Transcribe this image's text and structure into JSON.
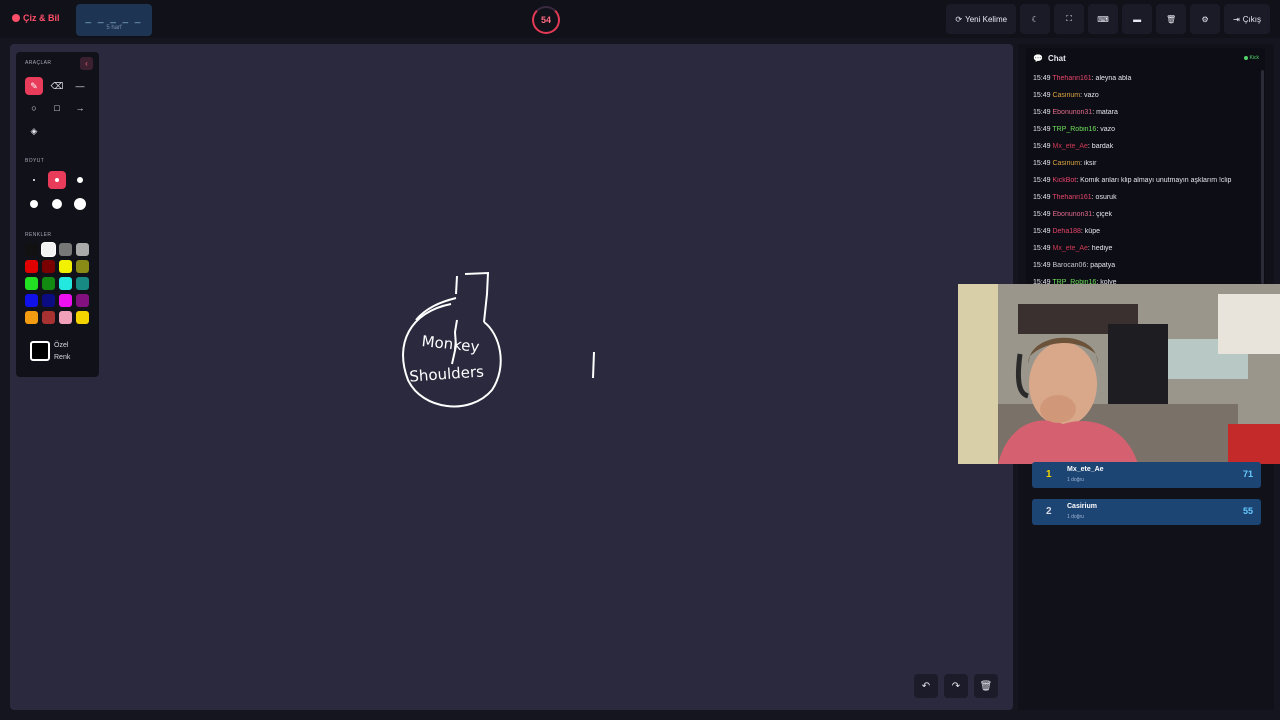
{
  "header": {
    "logo": "Çiz & Bil",
    "word_mask": "_ _ _ _ _",
    "word_hint": "5 harf",
    "timer": "54",
    "new_word": "Yeni Kelime",
    "exit": "Çıkış"
  },
  "tools": {
    "section_tools": "ARAÇLAR",
    "section_size": "BOYUT",
    "section_colors": "RENKLER",
    "custom_color_line1": "Özel",
    "custom_color_line2": "Renk",
    "colors": [
      "#111111",
      "#f2f2f2",
      "#777777",
      "#aaaaaa",
      "#e00000",
      "#7a0000",
      "#f2f200",
      "#8a8a16",
      "#22e022",
      "#128a12",
      "#22e8e0",
      "#178a84",
      "#1010e8",
      "#0c0c82",
      "#ee10ee",
      "#82107e",
      "#f39c12",
      "#a83232",
      "#f0a0b8",
      "#f3d400"
    ]
  },
  "drawing_text": "Monkey Shoulders",
  "chat": {
    "title": "Chat",
    "platform": "Kick",
    "messages": [
      {
        "time": "15:49",
        "user": "Thehanri161",
        "color": "#e8456a",
        "text": ": aleyna abla"
      },
      {
        "time": "15:49",
        "user": "Casirium",
        "color": "#d9a441",
        "text": ": vazo"
      },
      {
        "time": "15:49",
        "user": "Ebonunon31",
        "color": "#e06a8a",
        "text": ": matara"
      },
      {
        "time": "15:49",
        "user": "TRP_Robin16",
        "color": "#6fe05b",
        "text": ": vazo"
      },
      {
        "time": "15:49",
        "user": "Mx_ete_Ae",
        "color": "#cf3a55",
        "text": ": bardak"
      },
      {
        "time": "15:49",
        "user": "Casirium",
        "color": "#d9a441",
        "text": ": iksir"
      },
      {
        "time": "15:49",
        "user": "KickBot",
        "color": "#e8456a",
        "text": ": Komik anları klip almayı unutmayın aşklarım !clip"
      },
      {
        "time": "15:49",
        "user": "Thehanri161",
        "color": "#e8456a",
        "text": ": osuruk"
      },
      {
        "time": "15:49",
        "user": "Ebonunon31",
        "color": "#e06a8a",
        "text": ": çiçek"
      },
      {
        "time": "15:49",
        "user": "Deha188",
        "color": "#e8456a",
        "text": ": küpe"
      },
      {
        "time": "15:49",
        "user": "Mx_ete_Ae",
        "color": "#cf3a55",
        "text": ": hediye"
      },
      {
        "time": "15:49",
        "user": "Barocan06",
        "color": "#c8c8d4",
        "text": ": papatya"
      },
      {
        "time": "15:49",
        "user": "TRP_Robin16",
        "color": "#6fe05b",
        "text": ": kolye"
      }
    ]
  },
  "leaderboard": [
    {
      "rank": "1",
      "rank_color": "#f3d400",
      "name": "Mx_ete_Ae",
      "sub": "1 doğru",
      "score": "71"
    },
    {
      "rank": "2",
      "rank_color": "#d8d8e4",
      "name": "Casirium",
      "sub": "1 doğru",
      "score": "55"
    }
  ]
}
